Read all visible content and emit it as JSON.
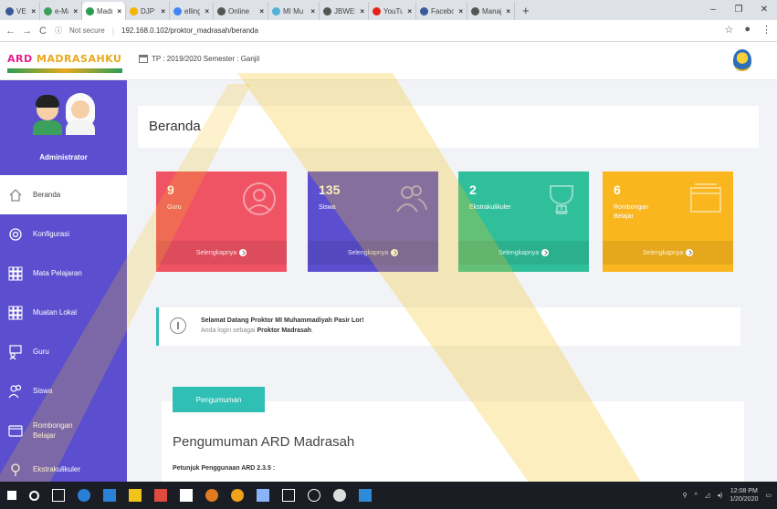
{
  "browser": {
    "tabs": [
      {
        "label": "VERVAL",
        "color": "#3b5998"
      },
      {
        "label": "e-Ma",
        "color": "#3aa05b"
      },
      {
        "label": "Madra",
        "color": "#2a9d55",
        "active": true
      },
      {
        "label": "DJP Or",
        "color": "#f5b400"
      },
      {
        "label": "elling",
        "color": "#4285f4"
      },
      {
        "label": "Online",
        "color": "#555555"
      },
      {
        "label": "MI Mu",
        "color": "#4fb3d9"
      },
      {
        "label": "JBWEB",
        "color": "#555555"
      },
      {
        "label": "YouTu",
        "color": "#e62117"
      },
      {
        "label": "Facebo",
        "color": "#3b5998"
      },
      {
        "label": "Manaj",
        "color": "#555555"
      }
    ],
    "not_secure": "Not secure",
    "url": "192.168.0.102/proktor_madrasah/beranda"
  },
  "header": {
    "logo_part1": "ARD",
    "logo_part2": "MADRASAHKU",
    "period": "TP : 2019/2020  Semester : Ganjil"
  },
  "sidebar": {
    "role": "Administrator",
    "items": [
      {
        "label": "Beranda",
        "icon": "home-icon"
      },
      {
        "label": "Konfigurasi",
        "icon": "gear-icon"
      },
      {
        "label": "Mata Pelajaran",
        "icon": "grid-icon"
      },
      {
        "label": "Muatan Lokal",
        "icon": "grid-icon"
      },
      {
        "label": "Guru",
        "icon": "teacher-icon"
      },
      {
        "label": "Siswa",
        "icon": "users-icon"
      },
      {
        "label": "Rombongan\nBelajar",
        "icon": "folder-icon"
      },
      {
        "label": "Ekstrakulikuler",
        "icon": "pin-icon"
      }
    ]
  },
  "main": {
    "title": "Beranda",
    "stats": [
      {
        "value": "9",
        "label": "Guru",
        "more": "Selengkapnya",
        "color": "#ef5364",
        "icon": "user-icon"
      },
      {
        "value": "135",
        "label": "Siswa",
        "more": "Selengkapnya",
        "color": "#5b4fcf",
        "icon": "users-icon"
      },
      {
        "value": "2",
        "label": "Ekstrakulikuler",
        "more": "Selengkapnya",
        "color": "#2fbf9b",
        "icon": "trophy-icon"
      },
      {
        "value": "6",
        "label": "Rombongan Belajar",
        "more": "Selengkapnya",
        "color": "#f9b61f",
        "icon": "folder-icon"
      }
    ],
    "welcome_title": "Selamat Datang Proktor MI Muhammadiyah Pasir Lor!",
    "welcome_prefix": "Anda login sebagai",
    "welcome_role": "Proktor Madrasah",
    "announcement_tab": "Pengumuman",
    "announcement_title": "Pengumuman ARD Madrasah",
    "announcement_sub": "Petunjuk Penggunaan ARD 2.3.5 :"
  },
  "taskbar": {
    "time": "12:08 PM",
    "date": "1/20/2020"
  }
}
